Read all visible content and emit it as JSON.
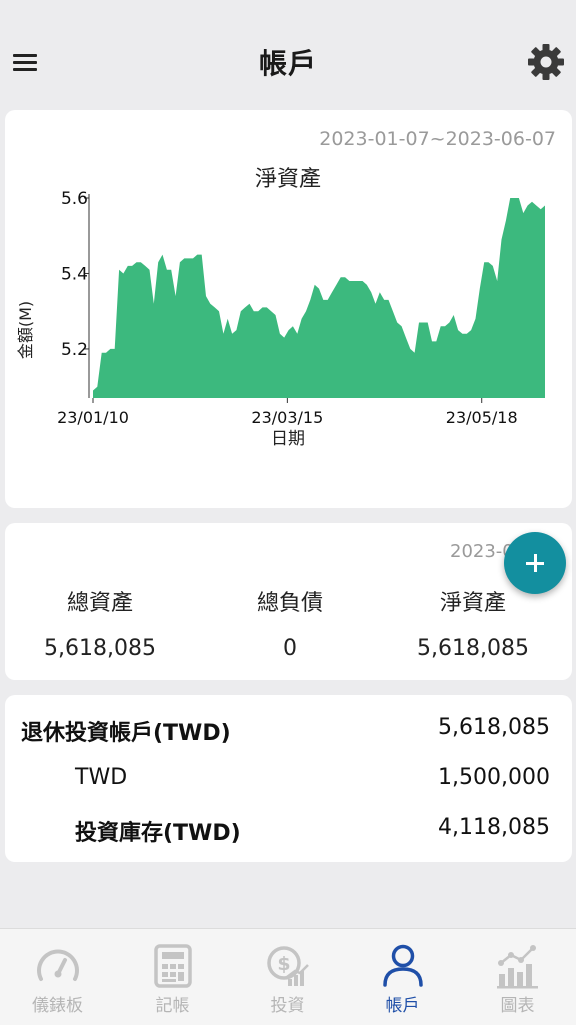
{
  "header": {
    "title": "帳戶",
    "menu_icon": "hamburger-menu-icon",
    "settings_icon": "gear-icon"
  },
  "chart_card": {
    "date_range": "2023-01-07~2023-06-07"
  },
  "chart_data": {
    "type": "area",
    "title": "淨資產",
    "xlabel": "日期",
    "ylabel": "金額(M)",
    "x_ticks": [
      "23/01/10",
      "23/03/15",
      "23/05/18"
    ],
    "y_ticks": [
      5.2,
      5.4,
      5.6
    ],
    "ylim": [
      5.07,
      5.6
    ],
    "color": "#3cb97e",
    "values": [
      5.09,
      5.1,
      5.19,
      5.19,
      5.2,
      5.2,
      5.41,
      5.4,
      5.42,
      5.42,
      5.43,
      5.43,
      5.42,
      5.41,
      5.32,
      5.43,
      5.45,
      5.41,
      5.41,
      5.34,
      5.43,
      5.44,
      5.44,
      5.44,
      5.45,
      5.45,
      5.34,
      5.32,
      5.31,
      5.3,
      5.24,
      5.28,
      5.24,
      5.25,
      5.3,
      5.31,
      5.32,
      5.3,
      5.3,
      5.31,
      5.31,
      5.3,
      5.29,
      5.24,
      5.23,
      5.25,
      5.26,
      5.24,
      5.28,
      5.3,
      5.33,
      5.37,
      5.36,
      5.33,
      5.33,
      5.35,
      5.37,
      5.39,
      5.39,
      5.38,
      5.38,
      5.38,
      5.38,
      5.37,
      5.35,
      5.32,
      5.35,
      5.33,
      5.33,
      5.3,
      5.27,
      5.26,
      5.23,
      5.2,
      5.19,
      5.27,
      5.27,
      5.27,
      5.22,
      5.22,
      5.26,
      5.26,
      5.27,
      5.29,
      5.25,
      5.24,
      5.24,
      5.25,
      5.28,
      5.36,
      5.43,
      5.43,
      5.42,
      5.38,
      5.49,
      5.54,
      5.6,
      5.6,
      5.6,
      5.56,
      5.58,
      5.59,
      5.58,
      5.57,
      5.58
    ]
  },
  "summary": {
    "date": "2023-0",
    "total_assets_label": "總資產",
    "total_liabilities_label": "總負債",
    "net_assets_label": "淨資產",
    "total_assets_value": "5,618,085",
    "total_liabilities_value": "0",
    "net_assets_value": "5,618,085"
  },
  "accounts": [
    {
      "name": "退休投資帳戶(TWD)",
      "value": "5,618,085"
    },
    {
      "name": "TWD",
      "value": "1,500,000"
    },
    {
      "name": "投資庫存(TWD)",
      "value": "4,118,085"
    }
  ],
  "fab": {
    "icon": "plus-icon"
  },
  "bottom_nav": [
    {
      "label": "儀錶板",
      "icon": "gauge-icon",
      "active": false
    },
    {
      "label": "記帳",
      "icon": "calculator-icon",
      "active": false
    },
    {
      "label": "投資",
      "icon": "dollar-growth-icon",
      "active": false
    },
    {
      "label": "帳戶",
      "icon": "user-icon",
      "active": true
    },
    {
      "label": "圖表",
      "icon": "bar-chart-icon",
      "active": false
    }
  ],
  "colors": {
    "accent": "#1f4fa8",
    "fab": "#138f9f",
    "chart_fill": "#3cb97e",
    "muted_text": "#9a9a9a"
  }
}
